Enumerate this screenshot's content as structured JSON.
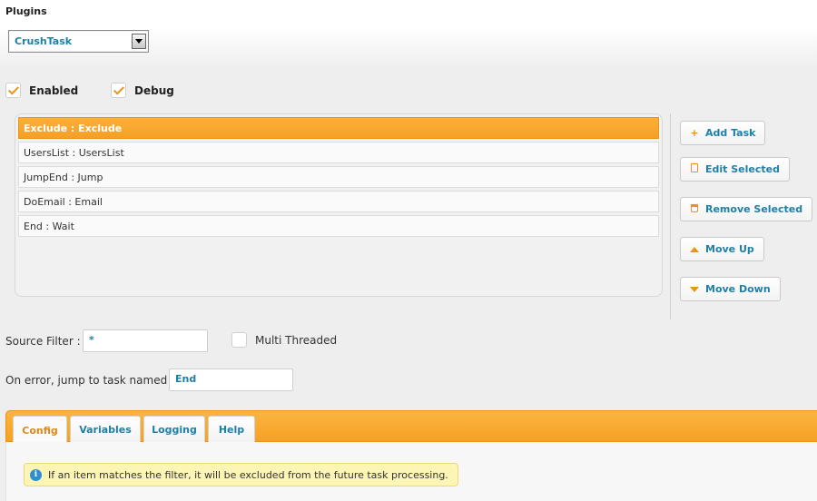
{
  "header": {
    "title": "Plugins"
  },
  "plugin_select": {
    "value": "CrushTask"
  },
  "options": {
    "enabled_label": "Enabled",
    "debug_label": "Debug",
    "enabled_checked": true,
    "debug_checked": true
  },
  "tasks": [
    {
      "label": "Exclude : Exclude",
      "selected": true
    },
    {
      "label": "UsersList : UsersList",
      "selected": false
    },
    {
      "label": "JumpEnd : Jump",
      "selected": false
    },
    {
      "label": "DoEmail : Email",
      "selected": false
    },
    {
      "label": "End : Wait",
      "selected": false
    }
  ],
  "buttons": {
    "add_task": "Add Task",
    "edit_selected": "Edit Selected",
    "remove_selected": "Remove Selected",
    "move_up": "Move Up",
    "move_down": "Move Down"
  },
  "source_filter": {
    "label": "Source Filter :",
    "value": "*"
  },
  "multi_threaded": {
    "label": "Multi Threaded",
    "checked": false
  },
  "on_error": {
    "label": "On error, jump to task named :",
    "value": "End"
  },
  "tabs": [
    {
      "label": "Config",
      "active": true
    },
    {
      "label": "Variables",
      "active": false
    },
    {
      "label": "Logging",
      "active": false
    },
    {
      "label": "Help",
      "active": false
    }
  ],
  "info_message": "If an item matches the filter, it will be excluded from the future task processing.",
  "colors": {
    "accent": "#f6a122",
    "link": "#1f7fa6",
    "info_bg": "#fcf5b6"
  }
}
